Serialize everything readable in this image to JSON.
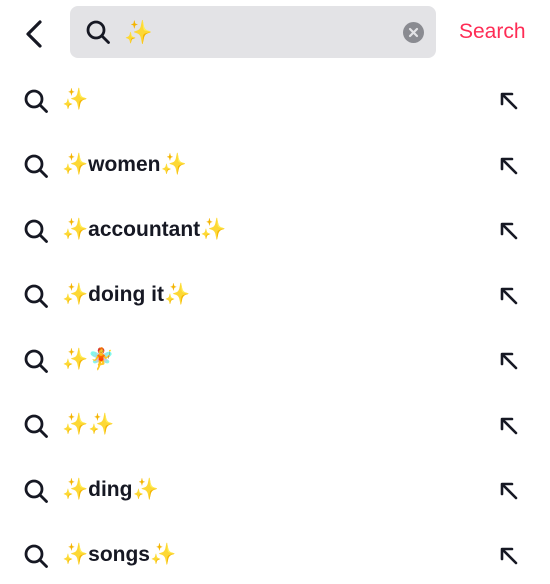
{
  "header": {
    "back_icon": "chevron-left-icon",
    "search_icon": "search-icon",
    "query": "✨",
    "clear_icon": "clear-circle-icon",
    "search_label": "Search"
  },
  "suggestions": [
    {
      "text": "✨"
    },
    {
      "text": "✨women✨"
    },
    {
      "text": "✨accountant✨"
    },
    {
      "text": "✨doing it✨"
    },
    {
      "text": "✨🧚"
    },
    {
      "text": "✨✨"
    },
    {
      "text": "✨ding✨"
    },
    {
      "text": "✨songs✨"
    }
  ],
  "colors": {
    "accent": "#fe2c55",
    "text": "#161823",
    "search_bg": "#e3e3e6",
    "clear_bg": "#8a8b91"
  }
}
